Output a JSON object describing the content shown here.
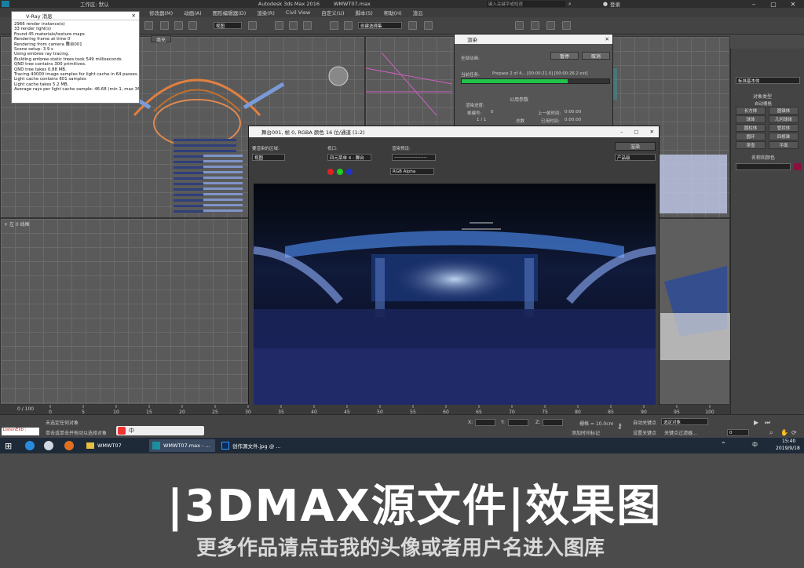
{
  "app": {
    "title": "Autodesk 3ds Max 2016",
    "file": "WMWT07.max",
    "workspace_label": "工作区: 默认",
    "search_placeholder": "键入关键字或短语",
    "login": "登录"
  },
  "menu": [
    "修改器(M)",
    "动画(A)",
    "图形编辑器(D)",
    "渲染(R)",
    "Civil View",
    "自定义(U)",
    "脚本(S)",
    "帮助(H)",
    "渲云"
  ],
  "toolbar": {
    "view_dropdown": "视图",
    "selection_set": "创建选择集"
  },
  "vray_log": {
    "title": "V-Ray 消息",
    "lines": [
      "2966 render instance(s)",
      "33 render light(s)",
      "Found 45 materials/texture maps",
      "Rendering frame at time 0",
      "Rendering from camera 舞台001",
      "Scene setup: 3.9 s",
      "Using embree ray tracing.",
      "Building embree static trees took 549 milliseconds",
      "QND tree contains 300 primitives.",
      "QND tree takes 0.88 MB.",
      "Tracing 40000 image samples for light cache in 64 passes.",
      "Light cache contains 601 samples",
      "Light cache takes 5.2 MB.",
      "Average rays per light cache sample: 46.68 (min 1, max 367)"
    ],
    "fill_label": "填充"
  },
  "render_dialog": {
    "title": "渲染",
    "pause_button": "暂停",
    "cancel_button": "取消",
    "overall_progress_label": "全部动画:",
    "current_task_label": "当前任务:",
    "current_task_value": "Prepass 2 of 4... [00:00:21.0] [00:00:26.2 est]",
    "progress": 0.72,
    "params_header": "公用参数",
    "progress_section_label": "渲染进度:",
    "frame_label": "帧编号:",
    "frame_value": "0",
    "count_value": "1 / 1",
    "total_label": "总数",
    "last_frame_label": "上一帧时间:",
    "last_frame_time": "0:00:00",
    "elapsed_label": "已用时间:",
    "elapsed_time": "0:00:00"
  },
  "frame_window": {
    "title": "舞台001, 帧 0, RGBA 颜色 16 位/通道 (1:2)",
    "area_label": "要渲染的区域:",
    "area_value": "视图",
    "viewport_label": "视口:",
    "viewport_value": "四元菜单 4 - 舞台",
    "preset_label": "渲染预设:",
    "preset_value": "---------------------",
    "render_button": "渲染",
    "quality_value": "产品级",
    "channel_value": "RGB Alpha"
  },
  "viewports": {
    "perspective_label": "+ 左 0 线框"
  },
  "command_panel": {
    "category_value": "标准基本体",
    "section_object_type": "对象类型",
    "auto_grid": "自动栅格",
    "buttons": [
      "长方体",
      "圆锥体",
      "球体",
      "几何球体",
      "圆柱体",
      "管状体",
      "圆环",
      "四棱锥",
      "茶壶",
      "平面"
    ],
    "name_color_header": "名称和颜色"
  },
  "timeline": {
    "frame_counter": "0 / 100",
    "ticks": [
      "0",
      "5",
      "10",
      "15",
      "20",
      "25",
      "30",
      "35",
      "40",
      "45",
      "50",
      "55",
      "60",
      "65",
      "70",
      "75",
      "80",
      "85",
      "90",
      "95",
      "100"
    ]
  },
  "status": {
    "maxscript": "'ListenElib':",
    "line1": "未选定任何对象",
    "line2": "单击或单击并拖动以选择对象",
    "x_label": "X:",
    "y_label": "Y:",
    "z_label": "Z:",
    "grid_label": "栅格 = 10.0cm",
    "auto_key": "自动关键点",
    "set_key": "设置关键点",
    "selected_obj": "选定对象",
    "key_filter": "关键点过滤器...",
    "add_time_tag": "添加时间标记",
    "frame_field": "0"
  },
  "taskbar": {
    "items": [
      "WMWT07",
      "WMWT07.max - ...",
      "创作源文件.jpg @ ..."
    ],
    "time": "15:40",
    "date": "2019/9/18",
    "ime": "中"
  },
  "banner": {
    "title": "|3DMAX源文件|效果图",
    "subtitle": "更多作品请点击我的头像或者用户名进入图库"
  },
  "colors": {
    "accent_green": "#21c44a",
    "title_bg": "#2e2e2e",
    "taskbar_bg": "#1e2a38",
    "banner_bg": "#4b4b4b"
  }
}
